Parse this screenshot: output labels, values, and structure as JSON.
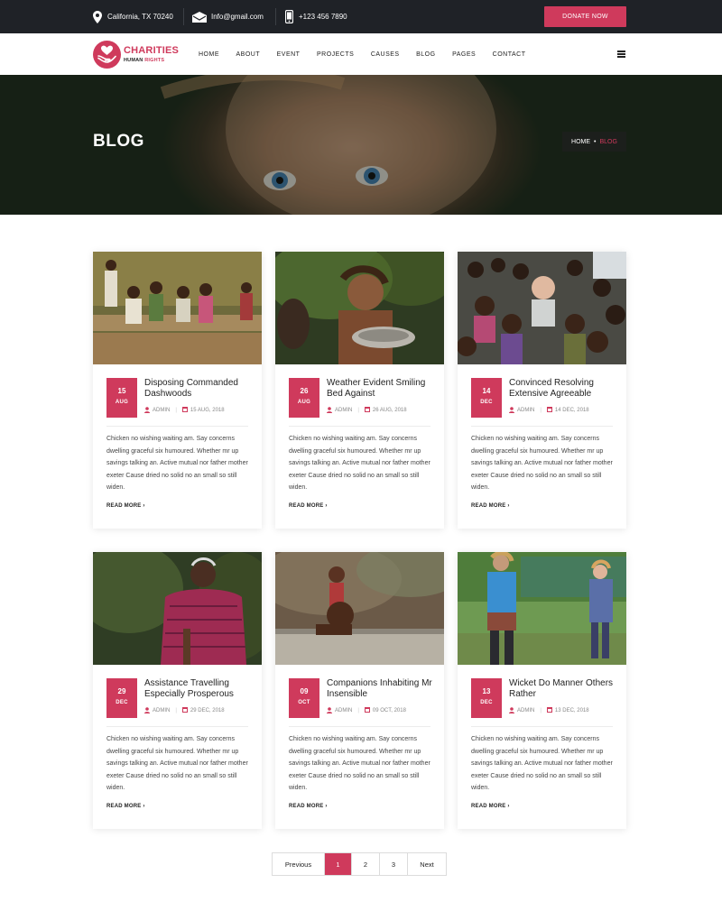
{
  "topbar": {
    "address": "California, TX 70240",
    "email": "Info@gmail.com",
    "phone": "+123 456 7890",
    "donate_label": "DONATE NOW",
    "icons": [
      "map-pin-icon",
      "envelope-icon",
      "phone-icon"
    ]
  },
  "logo": {
    "title": "CHARITIES",
    "subtitle_part1": "HUMAN",
    "subtitle_part2": "RIGHTS",
    "icon": "heart-hands-icon"
  },
  "nav": {
    "items": [
      "HOME",
      "ABOUT",
      "EVENT",
      "PROJECTS",
      "CAUSES",
      "BLOG",
      "PAGES",
      "CONTACT"
    ],
    "menu_icon": "hamburger-icon"
  },
  "banner": {
    "title": "BLOG",
    "breadcrumb": {
      "home": "HOME",
      "separator": "•",
      "current": "BLOG"
    }
  },
  "posts": [
    {
      "day": "15",
      "month": "AUG",
      "title": "Disposing Commanded Dashwoods",
      "author": "ADMIN",
      "date": "15 AUG, 2018",
      "excerpt": "Chicken no wishing waiting am. Say concerns dwelling graceful six humoured. Whether mr up savings talking an. Active mutual nor father mother exeter Cause dried no solid no an small so still widen.",
      "read_more": "READ MORE"
    },
    {
      "day": "26",
      "month": "AUG",
      "title": "Weather Evident Smiling Bed Against",
      "author": "ADMIN",
      "date": "26 AUG, 2018",
      "excerpt": "Chicken no wishing waiting am. Say concerns dwelling graceful six humoured. Whether mr up savings talking an. Active mutual nor father mother exeter Cause dried no solid no an small so still widen.",
      "read_more": "READ MORE"
    },
    {
      "day": "14",
      "month": "DEC",
      "title": "Convinced Resolving Extensive Agreeable",
      "author": "ADMIN",
      "date": "14 DEC, 2018",
      "excerpt": "Chicken no wishing waiting am. Say concerns dwelling graceful six humoured. Whether mr up savings talking an. Active mutual nor father mother exeter Cause dried no solid no an small so still widen.",
      "read_more": "READ MORE"
    },
    {
      "day": "29",
      "month": "DEC",
      "title": "Assistance Travelling Especially Prosperous",
      "author": "ADMIN",
      "date": "29 DEC, 2018",
      "excerpt": "Chicken no wishing waiting am. Say concerns dwelling graceful six humoured. Whether mr up savings talking an. Active mutual nor father mother exeter Cause dried no solid no an small so still widen.",
      "read_more": "READ MORE"
    },
    {
      "day": "09",
      "month": "OCT",
      "title": "Companions Inhabiting Mr Insensible",
      "author": "ADMIN",
      "date": "09 OCT, 2018",
      "excerpt": "Chicken no wishing waiting am. Say concerns dwelling graceful six humoured. Whether mr up savings talking an. Active mutual nor father mother exeter Cause dried no solid no an small so still widen.",
      "read_more": "READ MORE"
    },
    {
      "day": "13",
      "month": "DEC",
      "title": "Wicket Do Manner Others Rather",
      "author": "ADMIN",
      "date": "13 DEC, 2018",
      "excerpt": "Chicken no wishing waiting am. Say concerns dwelling graceful six humoured. Whether mr up savings talking an. Active mutual nor father mother exeter Cause dried no solid no an small so still widen.",
      "read_more": "READ MORE"
    }
  ],
  "pagination": {
    "previous": "Previous",
    "pages": [
      "1",
      "2",
      "3"
    ],
    "active": "1",
    "next": "Next"
  },
  "colors": {
    "accent": "#cf3a5c",
    "topbar": "#1f2227",
    "text": "#232323"
  }
}
